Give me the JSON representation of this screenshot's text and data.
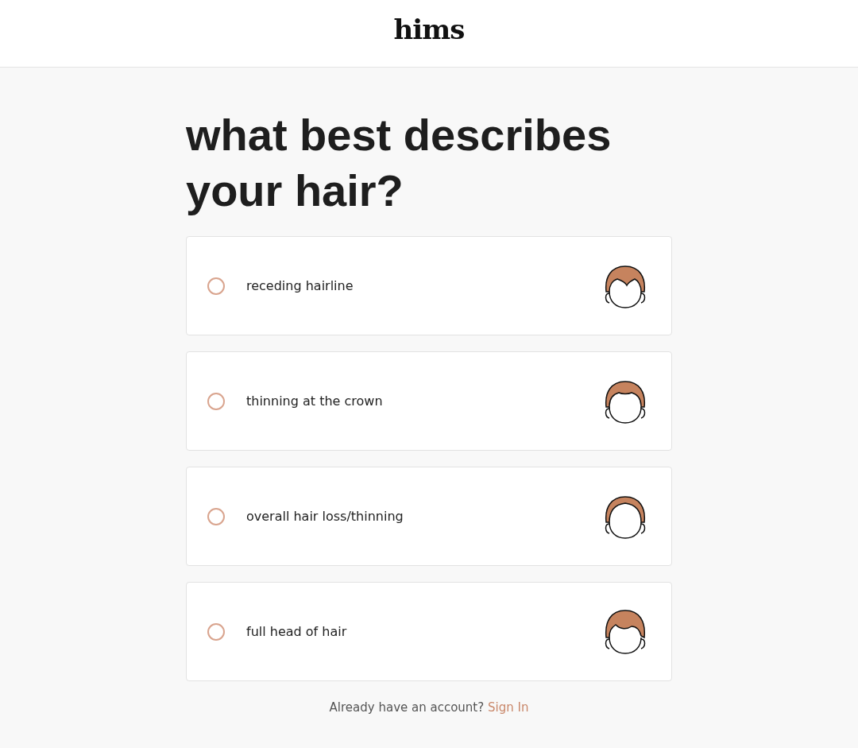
{
  "header": {
    "logo": "hims"
  },
  "question": "what best describes your hair?",
  "options": [
    {
      "label": "receding hairline",
      "selected": false
    },
    {
      "label": "thinning at the crown",
      "selected": false
    },
    {
      "label": "overall hair loss/thinning",
      "selected": false
    },
    {
      "label": "full head of hair",
      "selected": false
    }
  ],
  "footer": {
    "text": "Already have an account?",
    "link": "Sign In"
  }
}
